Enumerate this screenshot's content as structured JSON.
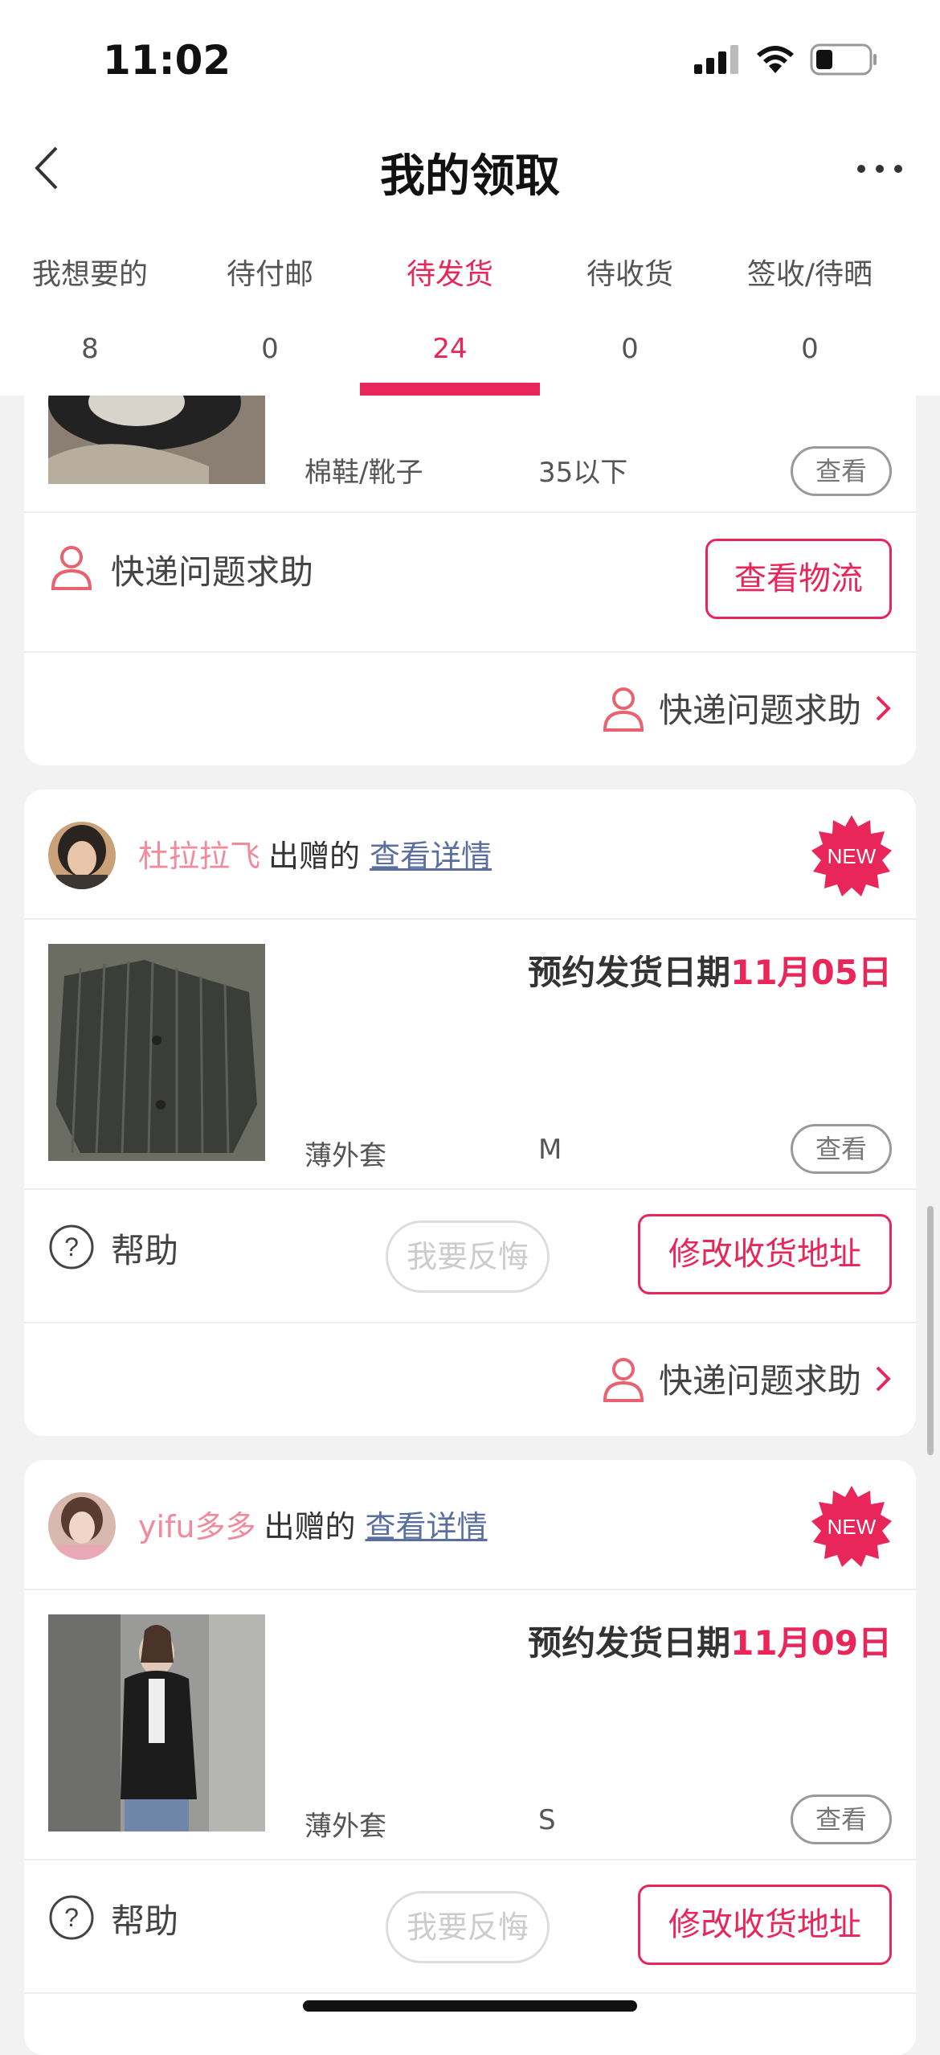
{
  "status_bar": {
    "time": "11:02"
  },
  "nav": {
    "title": "我的领取"
  },
  "tabs": [
    {
      "label": "我想要的",
      "count": "8"
    },
    {
      "label": "待付邮",
      "count": "0"
    },
    {
      "label": "待发货",
      "count": "24"
    },
    {
      "label": "待收货",
      "count": "0"
    },
    {
      "label": "签收/待晒",
      "count": "0"
    }
  ],
  "card0": {
    "category": "棉鞋/靴子",
    "size": "35以下",
    "view_label": "查看",
    "help_text": "快递问题求助",
    "logistics_label": "查看物流",
    "express_help": "快递问题求助"
  },
  "card1": {
    "donor_name": "杜拉拉飞",
    "donor_verb": "出赠的",
    "details_link": "查看详情",
    "new_badge": "NEW",
    "ship_date_label": "预约发货日期",
    "ship_date": "11月05日",
    "category": "薄外套",
    "size": "M",
    "view_label": "查看",
    "help_text": "帮助",
    "regret_label": "我要反悔",
    "change_address_label": "修改收货地址",
    "express_help": "快递问题求助"
  },
  "card2": {
    "donor_name": "yifu多多",
    "donor_verb": "出赠的",
    "details_link": "查看详情",
    "new_badge": "NEW",
    "ship_date_label": "预约发货日期",
    "ship_date": "11月09日",
    "category": "薄外套",
    "size": "S",
    "view_label": "查看",
    "help_text": "帮助",
    "regret_label": "我要反悔",
    "change_address_label": "修改收货地址"
  },
  "colors": {
    "accent": "#e8265a",
    "donor_name": "#f08a9c",
    "link": "#5b6f9e"
  }
}
